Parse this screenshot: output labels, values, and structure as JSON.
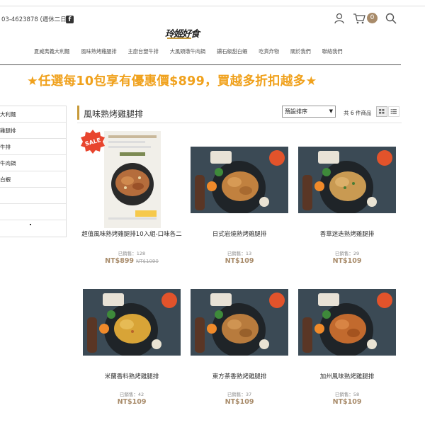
{
  "topbar": {
    "phone": "03-4623878 (週休二日)",
    "cart_count": "0"
  },
  "logo_text": "玲姬好食",
  "nav": [
    "夏威夷義大利麵",
    "風味熟烤雞腿排",
    "主廚台塑牛排",
    "大風頭燉牛肉鍋",
    "鑽石級甜白蝦",
    "吃貨炸物",
    "關於我們",
    "聯絡我們"
  ],
  "promo": "★任選每10包享有優惠價$899，買越多折扣越多★",
  "sidebar": {
    "items": [
      "大利麵",
      "雞腿排",
      "牛排",
      "牛肉鍋",
      "白蝦",
      "",
      "",
      ""
    ]
  },
  "section_title": "風味熟烤雞腿排",
  "sort": {
    "selected": "預設排序"
  },
  "count_text": "共 6 件商品",
  "sale_badge": "SALE",
  "products": [
    {
      "name": "超值風味熟烤雞腿排10入組-口味各二",
      "sold": "已銷售：128",
      "price": "NT$899",
      "old_price": "NT$1090"
    },
    {
      "name": "日式岩燒熟烤雞腿排",
      "sold": "已銷售：13",
      "price": "NT$109"
    },
    {
      "name": "香草迷迭熟烤雞腿排",
      "sold": "已銷售：29",
      "price": "NT$109"
    },
    {
      "name": "米蘭香料熟烤雞腿排",
      "sold": "已銷售：42",
      "price": "NT$109"
    },
    {
      "name": "東方茶香熟烤雞腿排",
      "sold": "已銷售：37",
      "price": "NT$109"
    },
    {
      "name": "加州風味熟烤雞腿排",
      "sold": "已銷售：58",
      "price": "NT$109"
    }
  ],
  "icons": {
    "facebook": "facebook-icon",
    "user": "user-icon",
    "cart": "cart-icon",
    "search": "search-icon"
  },
  "colors": {
    "accent": "#a88b6a",
    "promo": "#f0a11c",
    "sale": "#e8452e",
    "gold": "#c79a3a"
  }
}
